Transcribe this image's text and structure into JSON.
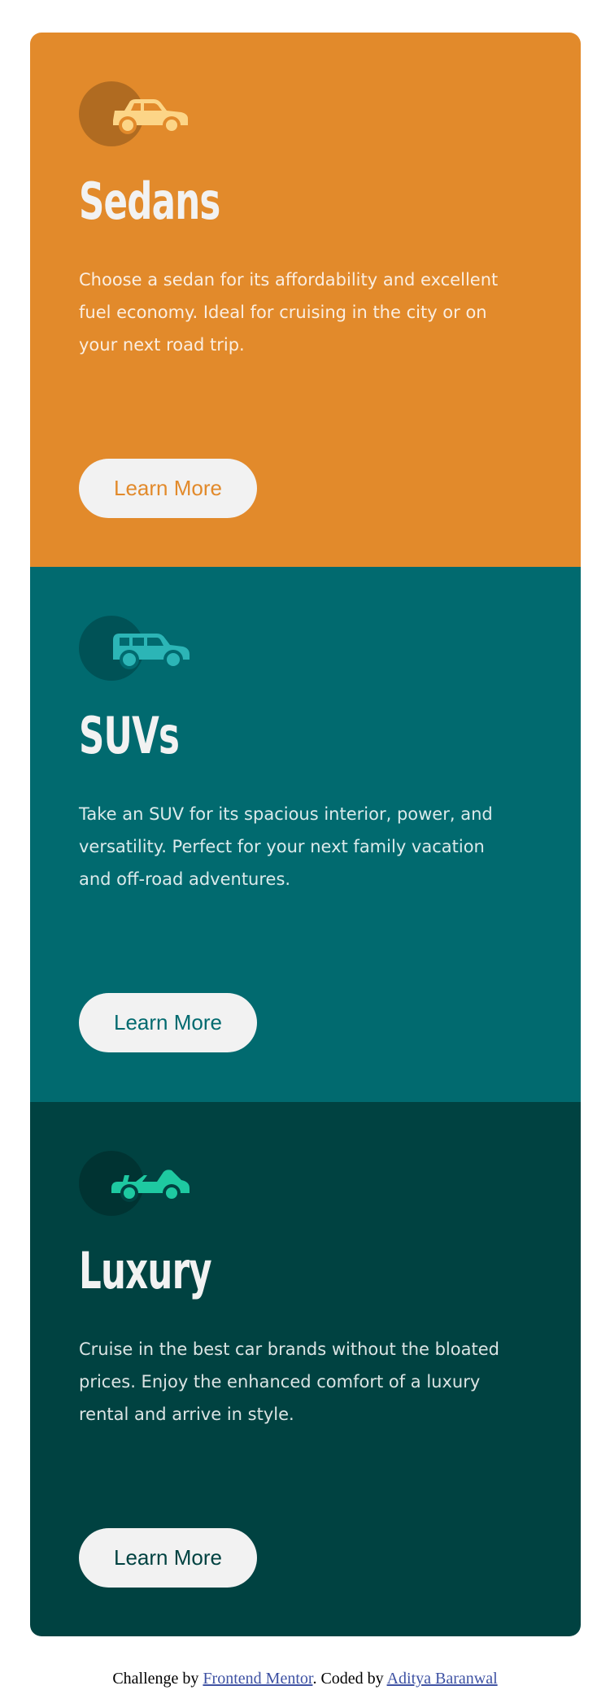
{
  "cards": [
    {
      "icon": "sedan-car-icon",
      "title": "Sedans",
      "description": "Choose a sedan for its affordability and excellent fuel economy. Ideal for cruising in the city or on your next road trip.",
      "button_label": "Learn More",
      "background": "#e28a2b",
      "icon_color": "#fcd587"
    },
    {
      "icon": "suv-car-icon",
      "title": "SUVs",
      "description": "Take an SUV for its spacious interior, power, and versatility. Perfect for your next family vacation and off-road adventures.",
      "button_label": "Learn More",
      "background": "#016a6f",
      "icon_color": "#2cb5b6"
    },
    {
      "icon": "luxury-convertible-icon",
      "title": "Luxury",
      "description": "Cruise in the best car brands without the bloated prices. Enjoy the enhanced comfort of a luxury rental and arrive in style.",
      "button_label": "Learn More",
      "background": "#004241",
      "icon_color": "#1ec9a1"
    }
  ],
  "attribution": {
    "prefix": "Challenge by",
    "link1": "Frontend Mentor",
    "middle": ". Coded by",
    "link2": "Aditya Baranwal"
  }
}
